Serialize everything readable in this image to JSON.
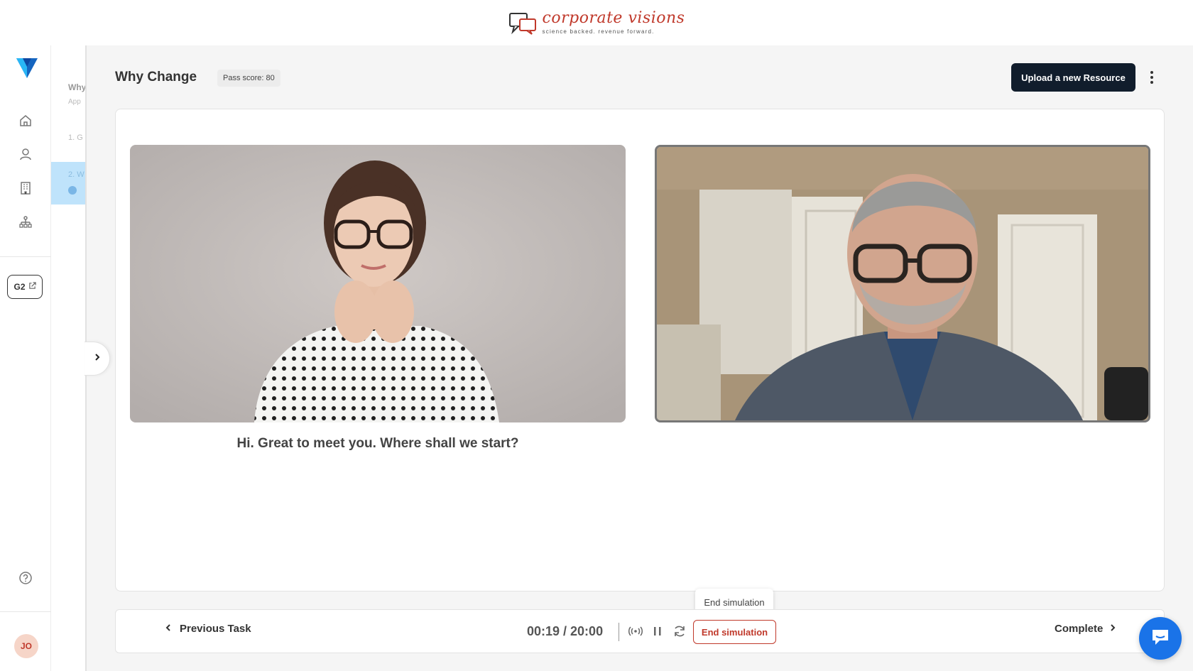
{
  "brand": {
    "name": "corporate visions",
    "tagline": "science backed. revenue forward."
  },
  "rail": {
    "items": [
      {
        "icon": "home-icon",
        "label": "Home"
      },
      {
        "icon": "user-icon",
        "label": "Profile"
      },
      {
        "icon": "building-icon",
        "label": "Organization"
      },
      {
        "icon": "hierarchy-icon",
        "label": "Teams"
      }
    ],
    "g2_label": "G2",
    "help_icon": "help-icon",
    "avatar_initials": "JO"
  },
  "subpanel": {
    "ghost_title": "Why",
    "ghost_sub": "App",
    "ghost_item1": "1. G",
    "ghost_item2": "2. W"
  },
  "header": {
    "title": "Why Change",
    "pass_score": "Pass score: 80",
    "upload_label": "Upload a new Resource"
  },
  "simulation": {
    "caption": "Hi. Great to meet you. Where shall we start?"
  },
  "controls": {
    "prev_label": "Previous Task",
    "timer": "00:19 / 20:00",
    "end_label": "End simulation",
    "tooltip": "End simulation",
    "complete_label": "Complete"
  },
  "colors": {
    "brand_red": "#c0392b",
    "primary_dark": "#111d2c",
    "chat_blue": "#1a73e8",
    "highlight": "#bfe3fb"
  }
}
